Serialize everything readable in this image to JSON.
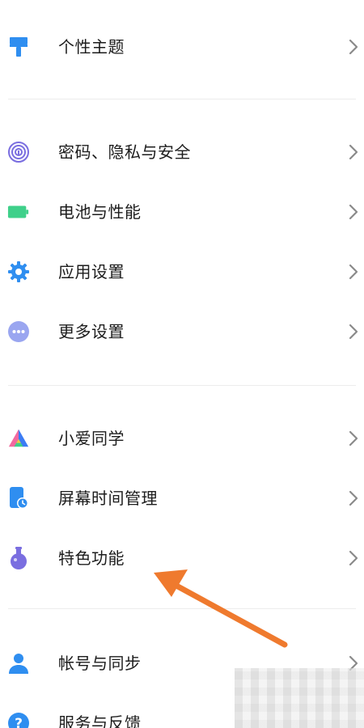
{
  "items": [
    {
      "label": "个性主题",
      "icon": "paint-roller-icon"
    },
    {
      "label": "密码、隐私与安全",
      "icon": "fingerprint-icon"
    },
    {
      "label": "电池与性能",
      "icon": "battery-icon"
    },
    {
      "label": "应用设置",
      "icon": "gear-icon"
    },
    {
      "label": "更多设置",
      "icon": "more-dots-icon"
    },
    {
      "label": "小爱同学",
      "icon": "xiaoai-logo-icon"
    },
    {
      "label": "屏幕时间管理",
      "icon": "screen-time-icon"
    },
    {
      "label": "特色功能",
      "icon": "flask-icon"
    },
    {
      "label": "帐号与同步",
      "icon": "person-icon"
    },
    {
      "label": "服务与反馈",
      "icon": "question-icon"
    }
  ],
  "colors": {
    "blue": "#2f8ef0",
    "green": "#3fd08a",
    "purple": "#7a6ee0",
    "arrow": "#ef7a2e",
    "chevron": "#8a8a8a"
  }
}
